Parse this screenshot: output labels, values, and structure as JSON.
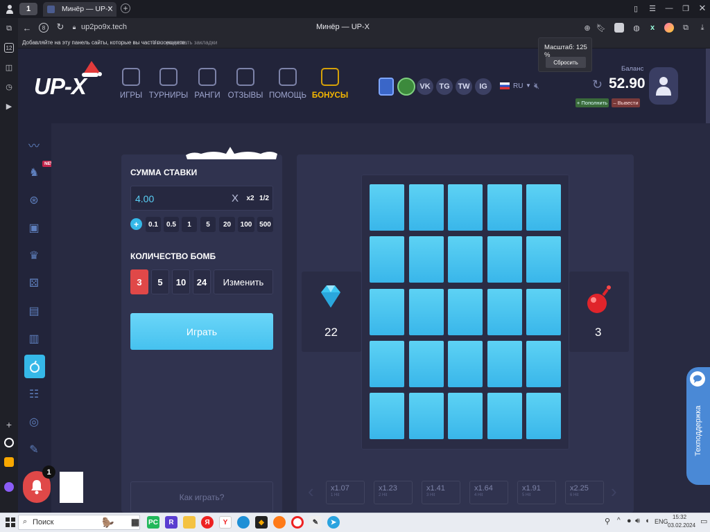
{
  "browser": {
    "tab_title": "Минёр — UP-X",
    "tab_close": "×",
    "new_tab": "+",
    "workspace_badge": "1",
    "url": "up2po9x.tech",
    "page_title": "Минёр — UP-X",
    "bookmarks_hint": "Добавляйте на эту панель сайты, которые вы часто посещаете.",
    "bookmarks_import": "Импортировать закладки",
    "sidebar_badge": "12",
    "zoom_popup": {
      "label": "Масштаб: 125 %",
      "reset": "Сбросить"
    }
  },
  "site": {
    "logo": "UP-X",
    "nav": [
      "ИГРЫ",
      "ТУРНИРЫ",
      "РАНГИ",
      "ОТЗЫВЫ",
      "ПОМОЩЬ",
      "БОНУСЫ"
    ],
    "social": [
      "VK",
      "TG",
      "TW",
      "IG"
    ],
    "language": "RU",
    "balance_label": "Баланс",
    "balance": "52.90",
    "deposit": "+ Пополнить",
    "withdraw": "– Вывести",
    "new_badge": "NEW",
    "bet": {
      "title": "СУММА СТАВКИ",
      "value": "4.00",
      "clear": "X",
      "x2": "x2",
      "half": "1/2",
      "plus": "+",
      "chips": [
        "0.1",
        "0.5",
        "1",
        "5",
        "20",
        "100",
        "500"
      ],
      "bombs_title": "КОЛИЧЕСТВО БОМБ",
      "bomb_options": [
        "3",
        "5",
        "10",
        "24"
      ],
      "bomb_selected": "3",
      "change": "Изменить",
      "play": "Играть",
      "how_to": "Как играть?"
    },
    "game": {
      "gems": "22",
      "bombs": "3",
      "grid_rows": 5,
      "grid_cols": 5,
      "multipliers": [
        {
          "value": "x1.07",
          "hits": "1 Hit"
        },
        {
          "value": "x1.23",
          "hits": "2 Hit"
        },
        {
          "value": "x1.41",
          "hits": "3 Hit"
        },
        {
          "value": "x1.64",
          "hits": "4 Hit"
        },
        {
          "value": "x1.91",
          "hits": "5 Hit"
        },
        {
          "value": "x2.25",
          "hits": "6 Hit"
        }
      ]
    },
    "support": "Техподдержка",
    "notification_count": "1"
  },
  "taskbar": {
    "search": "Поиск",
    "lang": "ENG",
    "time": "15:32",
    "date": "03.02.2024"
  },
  "colors": {
    "accent": "#5ad0f7",
    "bonus": "#f5b700",
    "bomb_red": "#e04848",
    "bg": "#23253a"
  }
}
